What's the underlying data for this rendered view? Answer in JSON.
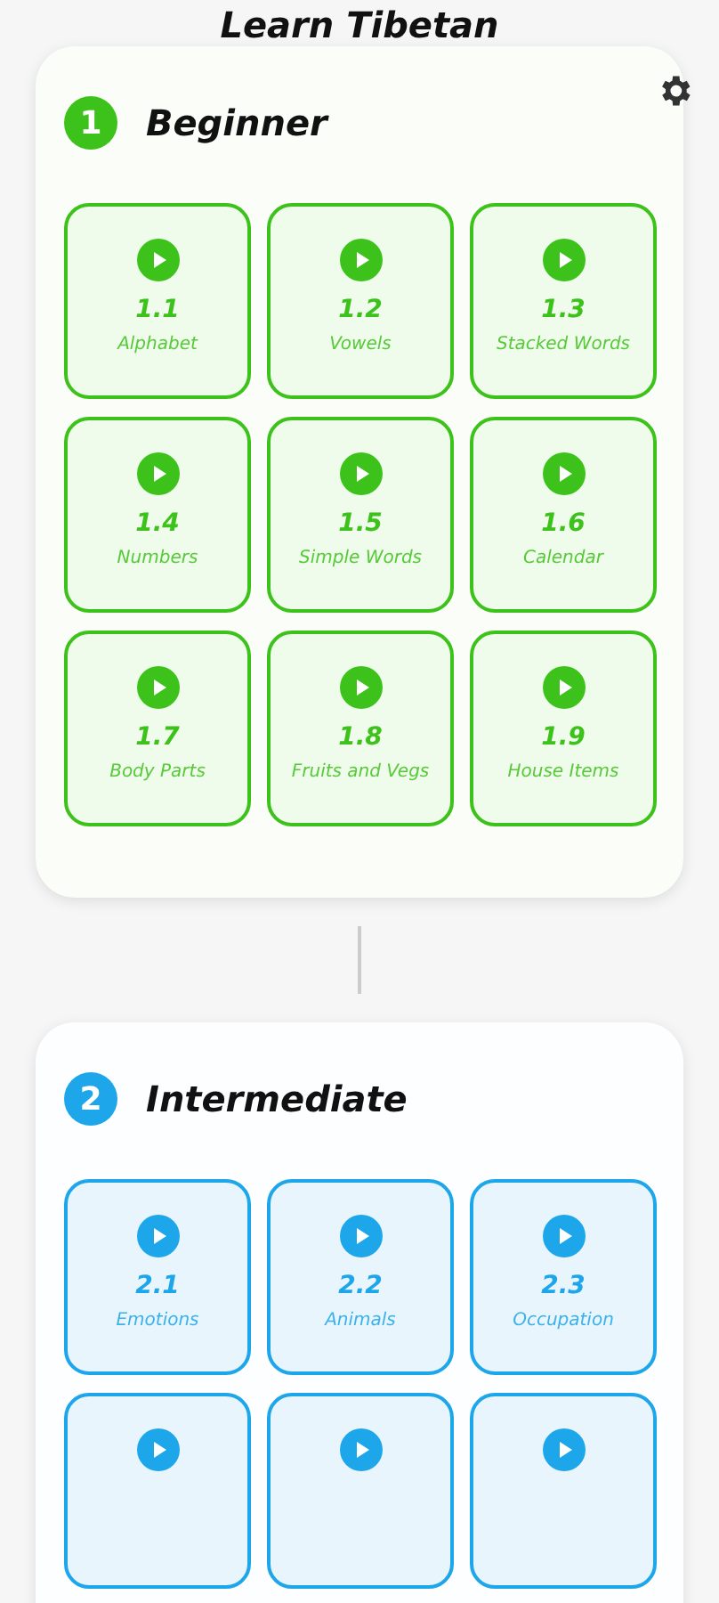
{
  "app_bar": {
    "title": "Learn Tibetan"
  },
  "sections": [
    {
      "number": "1",
      "title": "Beginner",
      "color": "#3cc21a",
      "lessons": [
        {
          "kind": "lesson",
          "number": "1.1",
          "label": "Alphabet"
        },
        {
          "kind": "lesson",
          "number": "1.2",
          "label": "Vowels"
        },
        {
          "kind": "lesson",
          "number": "1.3",
          "label": "Stacked Words"
        },
        {
          "kind": "lesson",
          "number": "1.4",
          "label": "Numbers"
        },
        {
          "kind": "lesson",
          "number": "1.5",
          "label": "Simple Words"
        },
        {
          "kind": "lesson",
          "number": "1.6",
          "label": "Calendar"
        },
        {
          "kind": "lesson",
          "number": "1.7",
          "label": "Body Parts"
        },
        {
          "kind": "lesson",
          "number": "1.8",
          "label": "Fruits and Vegs"
        },
        {
          "kind": "lesson",
          "number": "1.9",
          "label": "House Items"
        }
      ]
    },
    {
      "number": "2",
      "title": "Intermediate",
      "color": "#1ea6ea",
      "lessons": [
        {
          "kind": "lesson",
          "number": "2.1",
          "label": "Emotions"
        },
        {
          "kind": "lesson",
          "number": "2.2",
          "label": "Animals"
        },
        {
          "kind": "lesson",
          "number": "2.3",
          "label": "Occupation"
        },
        {
          "kind": "partial"
        },
        {
          "kind": "partial"
        },
        {
          "kind": "partial"
        }
      ]
    }
  ]
}
